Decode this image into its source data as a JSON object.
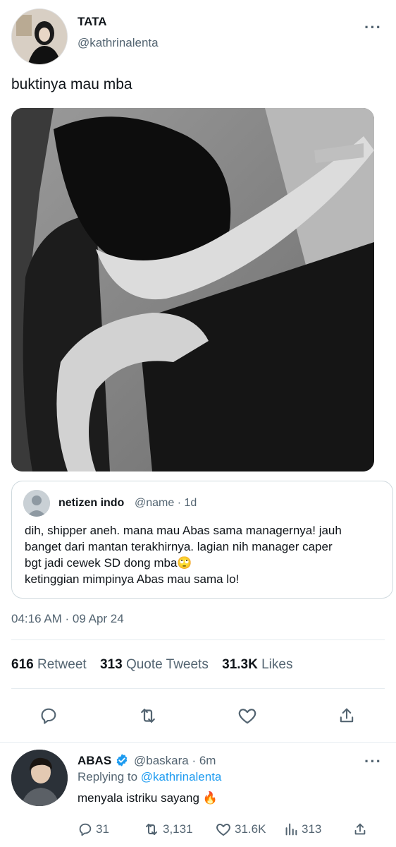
{
  "tweet": {
    "author_name": "TATA",
    "author_handle": "@kathrinalenta",
    "text": "buktinya mau mba",
    "timestamp": "04:16 AM · 09 Apr 24",
    "stats": {
      "retweets": "616",
      "retweets_label": "Retweet",
      "quotes": "313",
      "quotes_label": "Quote Tweets",
      "likes": "31.3K",
      "likes_label": "Likes"
    }
  },
  "quote": {
    "name": "netizen indo",
    "meta": "@name · 1d",
    "lines": [
      "dih, shipper aneh. mana mau Abas sama managernya! jauh",
      "banget dari mantan terakhirnya. lagian nih manager caper",
      "bgt jadi cewek SD dong mba🙄",
      "ketinggian mimpinya Abas mau sama lo!"
    ]
  },
  "reply": {
    "name": "ABAS",
    "handle_time": "@baskara · 6m",
    "replying_prefix": "Replying to ",
    "replying_to": "@kathrinalenta",
    "text": "menyala istriku sayang 🔥",
    "replies": "31",
    "retweets": "3,131",
    "likes": "31.6K",
    "views": "313"
  },
  "icons": {
    "more": "more-icon",
    "reply": "reply-icon",
    "retweet": "retweet-icon",
    "like": "heart-icon",
    "share": "share-icon",
    "views": "views-icon",
    "verified": "verified-badge-icon"
  },
  "colors": {
    "accent": "#1d9bf0",
    "secondary_text": "#536471",
    "primary_text": "#0f1419"
  }
}
